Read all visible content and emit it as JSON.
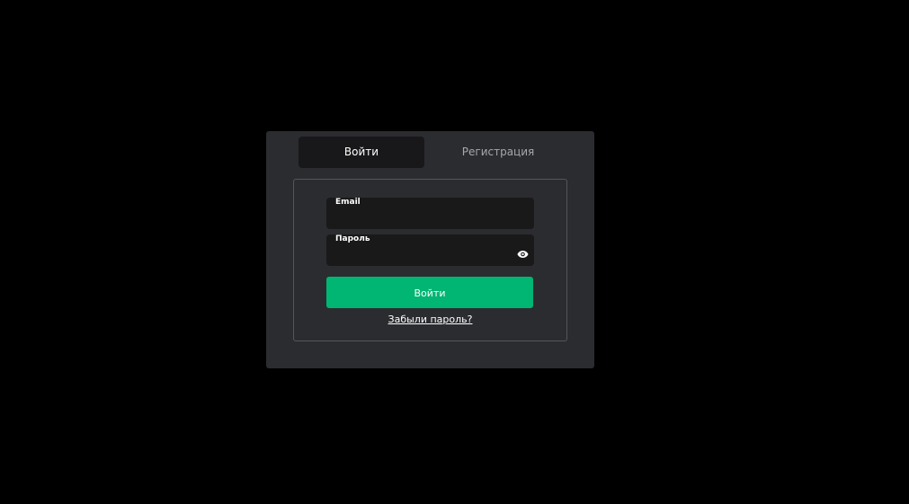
{
  "tabs": {
    "login": "Войти",
    "register": "Регистрация"
  },
  "form": {
    "email_label": "Email",
    "email_value": "",
    "password_label": "Пароль",
    "password_value": "",
    "password_toggle_icon": "eye-icon",
    "submit_label": "Войти",
    "forgot_label": "Забыли пароль?"
  },
  "colors": {
    "background": "#000000",
    "modal": "#2b2c30",
    "field": "#19191a",
    "accent": "#01b573"
  }
}
